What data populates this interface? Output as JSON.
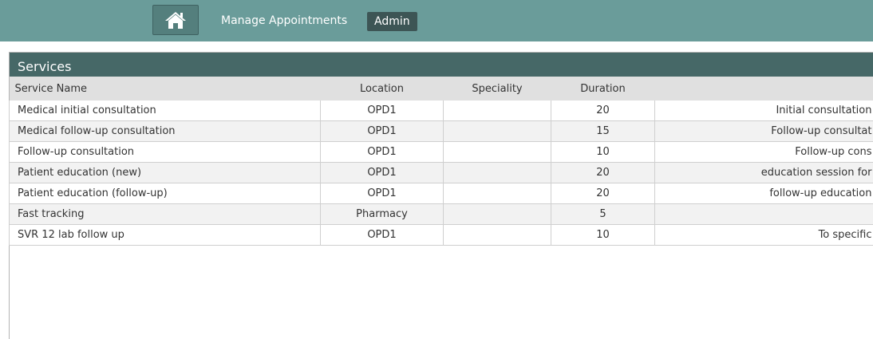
{
  "nav": {
    "home_icon": "home-icon",
    "manage_appointments": "Manage Appointments",
    "admin": "Admin"
  },
  "panel": {
    "title": "Services"
  },
  "table": {
    "headers": {
      "service_name": "Service Name",
      "location": "Location",
      "speciality": "Speciality",
      "duration": "Duration"
    },
    "rows": [
      {
        "name": "Medical initial consultation",
        "location": "OPD1",
        "speciality": "",
        "duration": "20",
        "description": "Initial consultation"
      },
      {
        "name": "Medical follow-up consultation",
        "location": "OPD1",
        "speciality": "",
        "duration": "15",
        "description": "Follow-up consultat"
      },
      {
        "name": "Follow-up consultation",
        "location": "OPD1",
        "speciality": "",
        "duration": "10",
        "description": "Follow-up cons"
      },
      {
        "name": "Patient education (new)",
        "location": "OPD1",
        "speciality": "",
        "duration": "20",
        "description": "education session for"
      },
      {
        "name": "Patient education (follow-up)",
        "location": "OPD1",
        "speciality": "",
        "duration": "20",
        "description": "follow-up education"
      },
      {
        "name": "Fast tracking",
        "location": "Pharmacy",
        "speciality": "",
        "duration": "5",
        "description": ""
      },
      {
        "name": "SVR 12 lab follow up",
        "location": "OPD1",
        "speciality": "",
        "duration": "10",
        "description": "To specific"
      }
    ]
  }
}
